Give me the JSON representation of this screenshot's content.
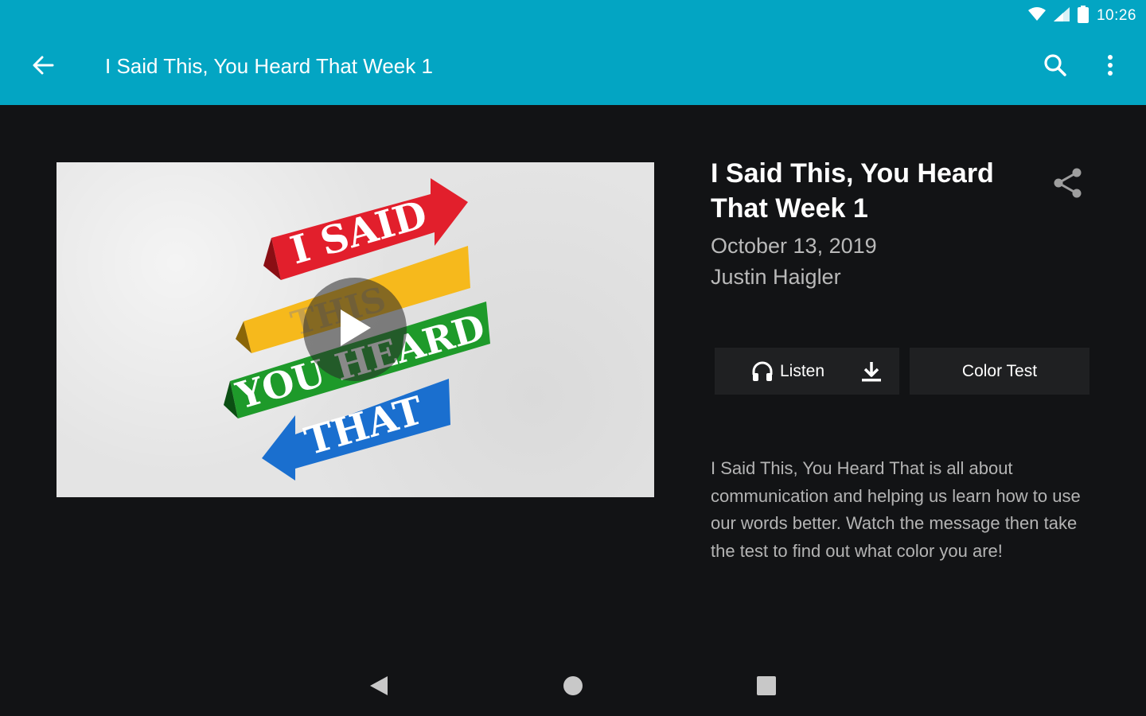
{
  "status_bar": {
    "time": "10:26"
  },
  "toolbar": {
    "title": "I Said This, You Heard That Week 1",
    "back_icon": "arrow-left-icon",
    "search_icon": "search-icon",
    "menu_icon": "more-vertical-icon"
  },
  "media": {
    "artwork_lines": [
      "I SAID",
      "THIS",
      "YOU HEARD",
      "THAT"
    ],
    "ribbon_colors": [
      "#e21f2c",
      "#f6b91c",
      "#1e9a2a",
      "#1a6fcf"
    ],
    "play_icon": "play-icon"
  },
  "details": {
    "title": "I Said This, You Heard That Week 1",
    "date": "October 13, 2019",
    "speaker": "Justin Haigler",
    "share_icon": "share-icon"
  },
  "actions": {
    "listen_label": "Listen",
    "color_test_label": "Color Test"
  },
  "description": "I Said This, You Heard That is all about communication and helping us learn how to use our words better. Watch the message then take the test to find out what color you are!",
  "colors": {
    "accent": "#03a5c3",
    "background": "#121315",
    "button_bg": "#1f2022"
  }
}
